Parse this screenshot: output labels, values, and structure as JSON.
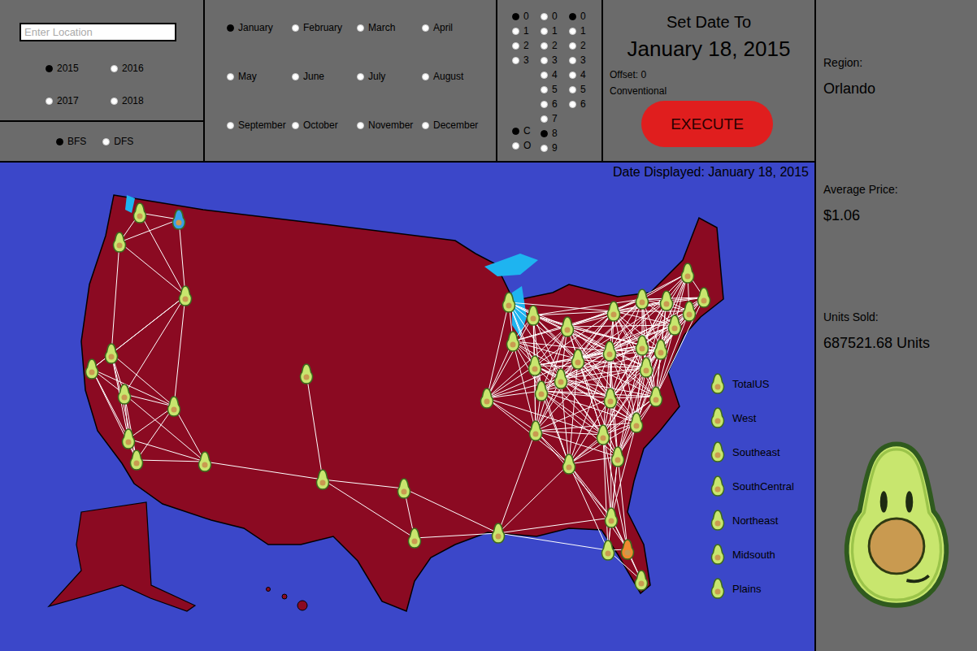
{
  "location_input": {
    "placeholder": "Enter Location"
  },
  "years": [
    {
      "label": "2015",
      "selected": true
    },
    {
      "label": "2016",
      "selected": false
    },
    {
      "label": "2017",
      "selected": false
    },
    {
      "label": "2018",
      "selected": false
    }
  ],
  "search_modes": [
    {
      "label": "BFS",
      "selected": true
    },
    {
      "label": "DFS",
      "selected": false
    }
  ],
  "months": [
    {
      "label": "January",
      "selected": true
    },
    {
      "label": "February",
      "selected": false
    },
    {
      "label": "March",
      "selected": false
    },
    {
      "label": "April",
      "selected": false
    },
    {
      "label": "May",
      "selected": false
    },
    {
      "label": "June",
      "selected": false
    },
    {
      "label": "July",
      "selected": false
    },
    {
      "label": "August",
      "selected": false
    },
    {
      "label": "September",
      "selected": false
    },
    {
      "label": "October",
      "selected": false
    },
    {
      "label": "November",
      "selected": false
    },
    {
      "label": "December",
      "selected": false
    }
  ],
  "digit_columns": [
    {
      "groups": [
        [
          {
            "label": "0",
            "selected": true
          },
          {
            "label": "1",
            "selected": false
          },
          {
            "label": "2",
            "selected": false
          },
          {
            "label": "3",
            "selected": false
          }
        ],
        [
          {
            "label": "C",
            "selected": true
          },
          {
            "label": "O",
            "selected": false
          }
        ]
      ]
    },
    {
      "groups": [
        [
          {
            "label": "0",
            "selected": false
          },
          {
            "label": "1",
            "selected": false
          },
          {
            "label": "2",
            "selected": false
          },
          {
            "label": "3",
            "selected": false
          },
          {
            "label": "4",
            "selected": false
          },
          {
            "label": "5",
            "selected": false
          },
          {
            "label": "6",
            "selected": false
          },
          {
            "label": "7",
            "selected": false
          },
          {
            "label": "8",
            "selected": true
          },
          {
            "label": "9",
            "selected": false
          }
        ]
      ]
    },
    {
      "groups": [
        [
          {
            "label": "0",
            "selected": true
          },
          {
            "label": "1",
            "selected": false
          },
          {
            "label": "2",
            "selected": false
          },
          {
            "label": "3",
            "selected": false
          },
          {
            "label": "4",
            "selected": false
          },
          {
            "label": "5",
            "selected": false
          },
          {
            "label": "6",
            "selected": false
          }
        ]
      ]
    }
  ],
  "set_date": {
    "title": "Set Date To",
    "date": "January 18, 2015",
    "offset": "Offset: 0",
    "type": "Conventional",
    "button": "EXECUTE"
  },
  "map": {
    "date_displayed": "Date Displayed: January 18, 2015",
    "pins": [
      {
        "color": "#c8e66e"
      },
      {
        "color": "#c8e66e"
      },
      {
        "color": "#3aa0e8"
      },
      {
        "color": "#c8e66e"
      },
      {
        "color": "#c8e66e"
      },
      {
        "color": "#c8e66e"
      },
      {
        "color": "#c8e66e"
      },
      {
        "color": "#c8e66e"
      },
      {
        "color": "#c8e66e"
      },
      {
        "color": "#c8e66e"
      },
      {
        "color": "#c8e66e"
      },
      {
        "color": "#c8e66e"
      },
      {
        "color": "#c8e66e"
      },
      {
        "color": "#c8e66e"
      },
      {
        "color": "#c8e66e"
      },
      {
        "color": "#c8e66e"
      },
      {
        "color": "#c8e66e"
      },
      {
        "color": "#c8e66e"
      },
      {
        "color": "#c8e66e"
      },
      {
        "color": "#c8e66e"
      },
      {
        "color": "#c8e66e"
      },
      {
        "color": "#c8e66e"
      },
      {
        "color": "#c8e66e"
      },
      {
        "color": "#c8e66e"
      },
      {
        "color": "#c8e66e"
      },
      {
        "color": "#c8e66e"
      },
      {
        "color": "#c8e66e"
      },
      {
        "color": "#c8e66e"
      },
      {
        "color": "#c8e66e"
      },
      {
        "color": "#c8e66e"
      },
      {
        "color": "#c8e66e"
      },
      {
        "color": "#c8e66e"
      },
      {
        "color": "#c8e66e"
      },
      {
        "color": "#c8e66e"
      },
      {
        "color": "#c8e66e"
      },
      {
        "color": "#c8e66e"
      },
      {
        "color": "#c8e66e"
      },
      {
        "color": "#c8e66e"
      },
      {
        "color": "#c8e66e"
      },
      {
        "color": "#c8e66e"
      },
      {
        "color": "#c8e66e"
      },
      {
        "color": "#c8e66e"
      },
      {
        "color": "#c8e66e"
      },
      {
        "color": "#c8e66e"
      },
      {
        "color": "#c8e66e"
      },
      {
        "color": "#f08a30"
      },
      {
        "color": "#c8e66e"
      }
    ],
    "legend": [
      {
        "label": "TotalUS"
      },
      {
        "label": "West"
      },
      {
        "label": "Southeast"
      },
      {
        "label": "SouthCentral"
      },
      {
        "label": "Northeast"
      },
      {
        "label": "Midsouth"
      },
      {
        "label": "Plains"
      }
    ]
  },
  "sidebar": {
    "fields": [
      {
        "label": "Region:",
        "value": "Orlando"
      },
      {
        "label": "Average Price:",
        "value": "$1.06"
      },
      {
        "label": "Units Sold:",
        "value": "687521.68 Units"
      }
    ]
  }
}
